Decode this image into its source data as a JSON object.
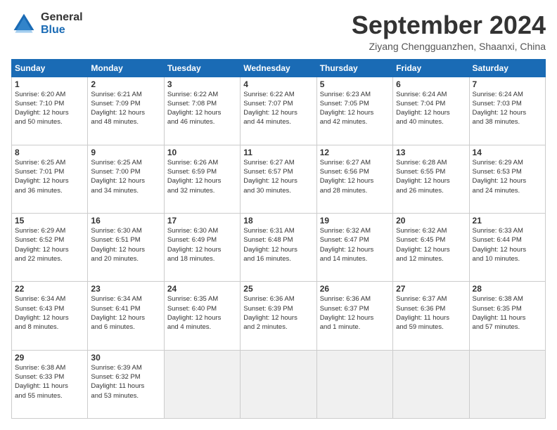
{
  "logo": {
    "general": "General",
    "blue": "Blue"
  },
  "title": "September 2024",
  "location": "Ziyang Chengguanzhen, Shaanxi, China",
  "days_of_week": [
    "Sunday",
    "Monday",
    "Tuesday",
    "Wednesday",
    "Thursday",
    "Friday",
    "Saturday"
  ],
  "cells": [
    {
      "day": "",
      "info": ""
    },
    {
      "day": "",
      "info": ""
    },
    {
      "day": "",
      "info": ""
    },
    {
      "day": "",
      "info": ""
    },
    {
      "day": "",
      "info": ""
    },
    {
      "day": "",
      "info": ""
    },
    {
      "day": "",
      "info": ""
    },
    {
      "day": "1",
      "info": "Sunrise: 6:20 AM\nSunset: 7:10 PM\nDaylight: 12 hours\nand 50 minutes."
    },
    {
      "day": "2",
      "info": "Sunrise: 6:21 AM\nSunset: 7:09 PM\nDaylight: 12 hours\nand 48 minutes."
    },
    {
      "day": "3",
      "info": "Sunrise: 6:22 AM\nSunset: 7:08 PM\nDaylight: 12 hours\nand 46 minutes."
    },
    {
      "day": "4",
      "info": "Sunrise: 6:22 AM\nSunset: 7:07 PM\nDaylight: 12 hours\nand 44 minutes."
    },
    {
      "day": "5",
      "info": "Sunrise: 6:23 AM\nSunset: 7:05 PM\nDaylight: 12 hours\nand 42 minutes."
    },
    {
      "day": "6",
      "info": "Sunrise: 6:24 AM\nSunset: 7:04 PM\nDaylight: 12 hours\nand 40 minutes."
    },
    {
      "day": "7",
      "info": "Sunrise: 6:24 AM\nSunset: 7:03 PM\nDaylight: 12 hours\nand 38 minutes."
    },
    {
      "day": "8",
      "info": "Sunrise: 6:25 AM\nSunset: 7:01 PM\nDaylight: 12 hours\nand 36 minutes."
    },
    {
      "day": "9",
      "info": "Sunrise: 6:25 AM\nSunset: 7:00 PM\nDaylight: 12 hours\nand 34 minutes."
    },
    {
      "day": "10",
      "info": "Sunrise: 6:26 AM\nSunset: 6:59 PM\nDaylight: 12 hours\nand 32 minutes."
    },
    {
      "day": "11",
      "info": "Sunrise: 6:27 AM\nSunset: 6:57 PM\nDaylight: 12 hours\nand 30 minutes."
    },
    {
      "day": "12",
      "info": "Sunrise: 6:27 AM\nSunset: 6:56 PM\nDaylight: 12 hours\nand 28 minutes."
    },
    {
      "day": "13",
      "info": "Sunrise: 6:28 AM\nSunset: 6:55 PM\nDaylight: 12 hours\nand 26 minutes."
    },
    {
      "day": "14",
      "info": "Sunrise: 6:29 AM\nSunset: 6:53 PM\nDaylight: 12 hours\nand 24 minutes."
    },
    {
      "day": "15",
      "info": "Sunrise: 6:29 AM\nSunset: 6:52 PM\nDaylight: 12 hours\nand 22 minutes."
    },
    {
      "day": "16",
      "info": "Sunrise: 6:30 AM\nSunset: 6:51 PM\nDaylight: 12 hours\nand 20 minutes."
    },
    {
      "day": "17",
      "info": "Sunrise: 6:30 AM\nSunset: 6:49 PM\nDaylight: 12 hours\nand 18 minutes."
    },
    {
      "day": "18",
      "info": "Sunrise: 6:31 AM\nSunset: 6:48 PM\nDaylight: 12 hours\nand 16 minutes."
    },
    {
      "day": "19",
      "info": "Sunrise: 6:32 AM\nSunset: 6:47 PM\nDaylight: 12 hours\nand 14 minutes."
    },
    {
      "day": "20",
      "info": "Sunrise: 6:32 AM\nSunset: 6:45 PM\nDaylight: 12 hours\nand 12 minutes."
    },
    {
      "day": "21",
      "info": "Sunrise: 6:33 AM\nSunset: 6:44 PM\nDaylight: 12 hours\nand 10 minutes."
    },
    {
      "day": "22",
      "info": "Sunrise: 6:34 AM\nSunset: 6:43 PM\nDaylight: 12 hours\nand 8 minutes."
    },
    {
      "day": "23",
      "info": "Sunrise: 6:34 AM\nSunset: 6:41 PM\nDaylight: 12 hours\nand 6 minutes."
    },
    {
      "day": "24",
      "info": "Sunrise: 6:35 AM\nSunset: 6:40 PM\nDaylight: 12 hours\nand 4 minutes."
    },
    {
      "day": "25",
      "info": "Sunrise: 6:36 AM\nSunset: 6:39 PM\nDaylight: 12 hours\nand 2 minutes."
    },
    {
      "day": "26",
      "info": "Sunrise: 6:36 AM\nSunset: 6:37 PM\nDaylight: 12 hours\nand 1 minute."
    },
    {
      "day": "27",
      "info": "Sunrise: 6:37 AM\nSunset: 6:36 PM\nDaylight: 11 hours\nand 59 minutes."
    },
    {
      "day": "28",
      "info": "Sunrise: 6:38 AM\nSunset: 6:35 PM\nDaylight: 11 hours\nand 57 minutes."
    },
    {
      "day": "29",
      "info": "Sunrise: 6:38 AM\nSunset: 6:33 PM\nDaylight: 11 hours\nand 55 minutes."
    },
    {
      "day": "30",
      "info": "Sunrise: 6:39 AM\nSunset: 6:32 PM\nDaylight: 11 hours\nand 53 minutes."
    },
    {
      "day": "",
      "info": ""
    },
    {
      "day": "",
      "info": ""
    },
    {
      "day": "",
      "info": ""
    },
    {
      "day": "",
      "info": ""
    },
    {
      "day": "",
      "info": ""
    }
  ]
}
